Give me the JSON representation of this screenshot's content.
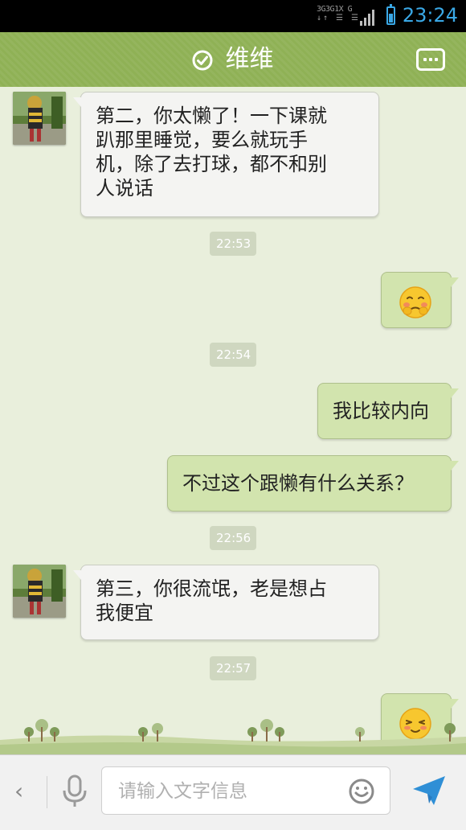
{
  "status_bar": {
    "network_labels": [
      "3G",
      "3G",
      "1X",
      "G"
    ],
    "time": "23:24",
    "colors": {
      "accent": "#3aa8e6"
    }
  },
  "header": {
    "title": "维维",
    "verified_icon": "check-circle-icon",
    "menu_icon": "more-options-icon",
    "background_color": "#8fb155"
  },
  "messages": [
    {
      "type": "incoming",
      "avatar": "contact-avatar",
      "text_lines": [
        "第二，你太懒了！一下课就",
        "趴那里睡觉，要么就玩手",
        "机，除了去打球，都不和别",
        "人说话"
      ]
    },
    {
      "type": "timestamp",
      "text": "22:53"
    },
    {
      "type": "outgoing",
      "emoji": "shy-face-emoji"
    },
    {
      "type": "timestamp",
      "text": "22:54"
    },
    {
      "type": "outgoing",
      "text": "我比较内向"
    },
    {
      "type": "outgoing",
      "text": "不过这个跟懒有什么关系？"
    },
    {
      "type": "timestamp",
      "text": "22:56"
    },
    {
      "type": "incoming",
      "avatar": "contact-avatar",
      "text_lines": [
        "第三，你很流氓，老是想占",
        "我便宜"
      ]
    },
    {
      "type": "timestamp",
      "text": "22:57"
    },
    {
      "type": "outgoing",
      "emoji": "content-face-emoji"
    }
  ],
  "input_bar": {
    "back_icon": "chevron-left-icon",
    "back_glyph": "‹",
    "voice_icon": "microphone-icon",
    "placeholder": "请输入文字信息",
    "emoji_icon": "smiley-icon",
    "send_icon": "paper-plane-icon"
  },
  "colors": {
    "chat_background": "#e9efdc",
    "incoming_bubble": "#f4f4f2",
    "outgoing_bubble": "#d2e4ae",
    "send_accent": "#2f8fd6"
  }
}
